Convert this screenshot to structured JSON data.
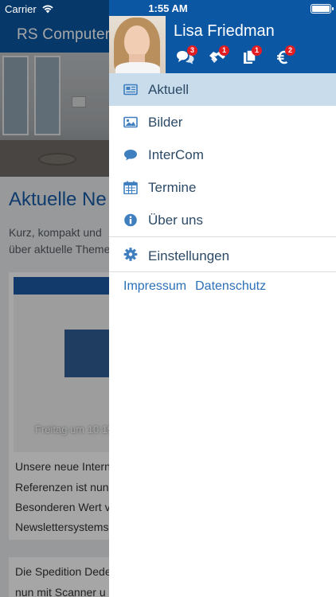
{
  "status_bar": {
    "carrier": "Carrier",
    "time": "1:55 AM"
  },
  "background_page": {
    "app_title": "RS Computer",
    "heading": "Aktuelle Ne",
    "intro_line1": "Kurz, kompakt und",
    "intro_line2": "über aktuelle Theme",
    "card1": {
      "date": "Freitag um 10:19",
      "line1": "Unsere neue Intern",
      "line2": "Referenzen ist nun",
      "line3": "Besonderen Wert v",
      "line4": "Newslettersystems"
    },
    "card2": {
      "line1": "Die Spedition Dede",
      "line2": "nun mit Scanner u"
    }
  },
  "drawer": {
    "user_name": "Lisa Friedman",
    "header_icons": [
      {
        "icon": "chat-bubbles-icon",
        "badge": "3"
      },
      {
        "icon": "handshake-icon",
        "badge": "1"
      },
      {
        "icon": "documents-icon",
        "badge": "1"
      },
      {
        "icon": "euro-icon",
        "badge": "2"
      }
    ],
    "menu": [
      {
        "label": "Aktuell",
        "icon": "newspaper-icon",
        "active": true
      },
      {
        "label": "Bilder",
        "icon": "image-icon",
        "active": false
      },
      {
        "label": "InterCom",
        "icon": "speech-bubble-icon",
        "active": false
      },
      {
        "label": "Termine",
        "icon": "calendar-icon",
        "active": false
      },
      {
        "label": "Über uns",
        "icon": "info-icon",
        "active": false
      }
    ],
    "settings_label": "Einstellungen",
    "footer": {
      "impressum": "Impressum",
      "datenschutz": "Datenschutz"
    }
  },
  "colors": {
    "brand_blue": "#0b57a4",
    "active_row": "#c9dcec",
    "badge_red": "#e21d23",
    "link_blue": "#2b70b8"
  }
}
